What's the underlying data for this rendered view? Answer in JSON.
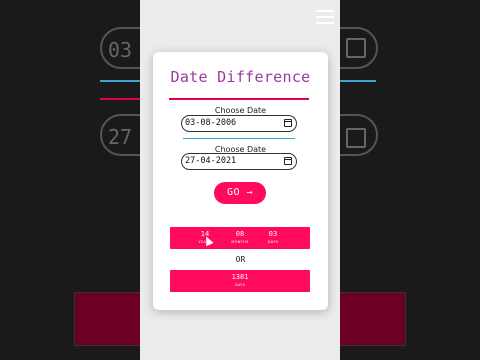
{
  "app": {
    "title": "Date Difference"
  },
  "form": {
    "date1_label": "Choose Date",
    "date1_value": "03-08-2006",
    "date2_label": "Choose Date",
    "date2_value": "27-04-2021",
    "go_label": "GO →"
  },
  "result": {
    "years_value": "14",
    "years_label": "YEARS",
    "months_value": "08",
    "months_label": "MONTHS",
    "days_value": "03",
    "days_label": "DAYS",
    "or_text": "OR",
    "total_days_value": "1381",
    "total_days_label": "DAYS"
  },
  "background": {
    "left_date1": "03 -",
    "left_date2": "27 -"
  },
  "colors": {
    "accent": "#ff0a5c",
    "title": "#9b3aa0",
    "underline": "#3aa6d0"
  },
  "icons": [
    "menu-icon",
    "calendar-icon"
  ]
}
